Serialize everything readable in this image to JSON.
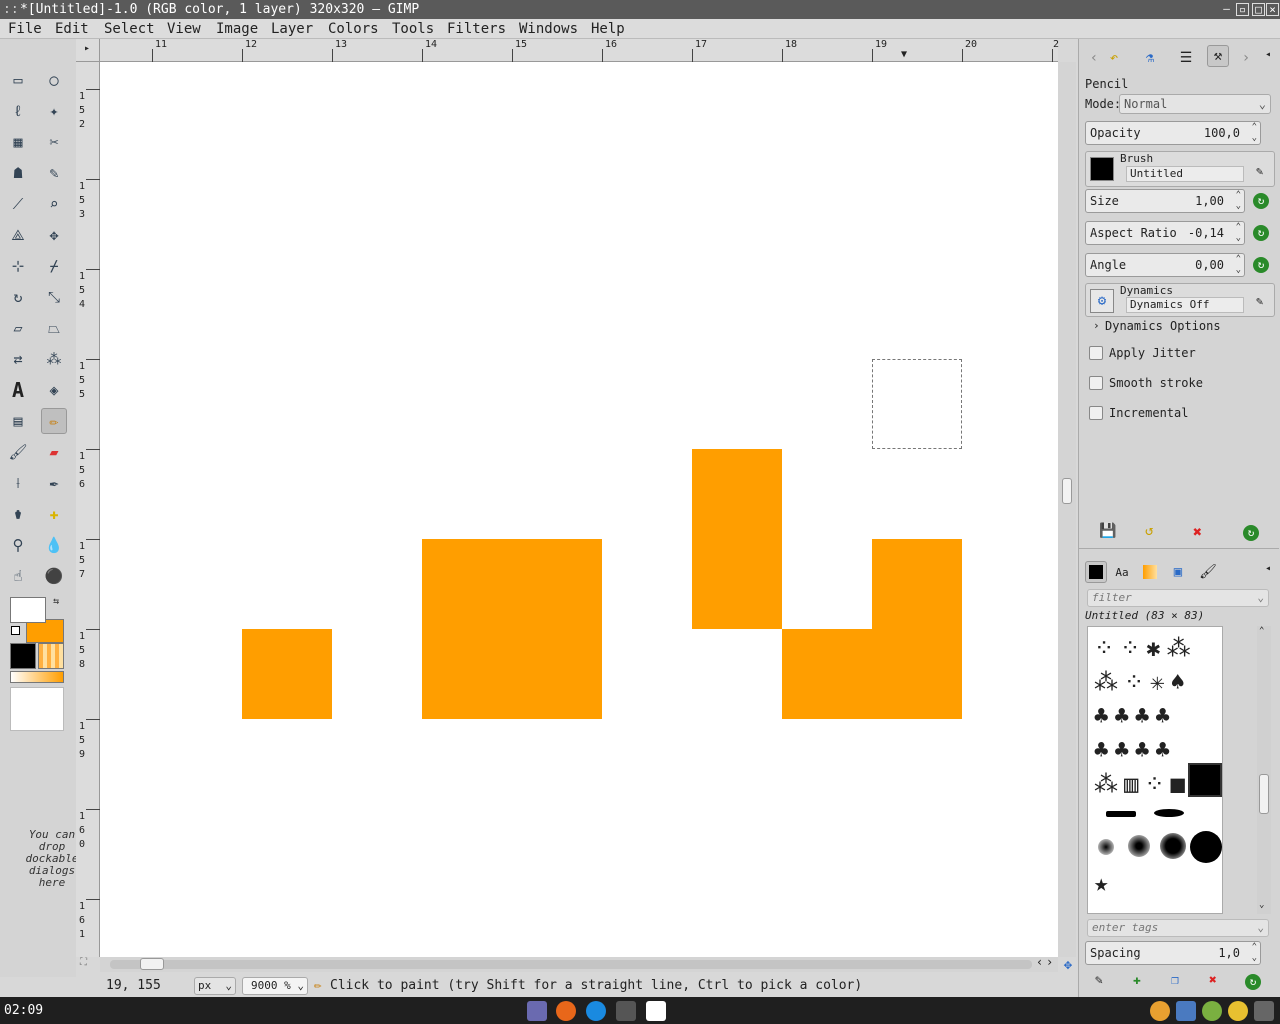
{
  "window": {
    "title": "*[Untitled]-1.0 (RGB color, 1 layer) 320x320 – GIMP",
    "grip": "::"
  },
  "menu": [
    "File",
    "Edit",
    "Select",
    "View",
    "Image",
    "Layer",
    "Colors",
    "Tools",
    "Filters",
    "Windows",
    "Help"
  ],
  "toolbox": {
    "drop_hint": "You can drop dockable dialogs here"
  },
  "rulers": {
    "horizontal": [
      "11",
      "12",
      "13",
      "14",
      "15",
      "16",
      "17",
      "18",
      "19",
      "20",
      "2"
    ],
    "vertical": [
      [
        "1",
        "5",
        "2"
      ],
      [
        "1",
        "5",
        "3"
      ],
      [
        "1",
        "5",
        "4"
      ],
      [
        "1",
        "5",
        "5"
      ],
      [
        "1",
        "5",
        "6"
      ],
      [
        "1",
        "5",
        "7"
      ],
      [
        "1",
        "5",
        "8"
      ],
      [
        "1",
        "5",
        "9"
      ],
      [
        "1",
        "6",
        "0"
      ],
      [
        "1",
        "6",
        "1"
      ]
    ]
  },
  "canvas": {
    "fill_color": "#ff9e00"
  },
  "statusbar": {
    "coords": "19, 155",
    "unit": "px",
    "zoom": "9000 %",
    "message": "Click to paint (try Shift for a straight line, Ctrl to pick a color)"
  },
  "tool_options": {
    "tool_name": "Pencil",
    "mode_label": "Mode:",
    "mode_value": "Normal",
    "opacity_label": "Opacity",
    "opacity_value": "100,0",
    "brush_label": "Brush",
    "brush_value": "Untitled",
    "size_label": "Size",
    "size_value": "1,00",
    "aspect_label": "Aspect Ratio",
    "aspect_value": "-0,14",
    "angle_label": "Angle",
    "angle_value": "0,00",
    "dynamics_label": "Dynamics",
    "dynamics_value": "Dynamics Off",
    "dynamics_options": "Dynamics Options",
    "apply_jitter": "Apply Jitter",
    "smooth_stroke": "Smooth stroke",
    "incremental": "Incremental"
  },
  "brushes": {
    "filter_placeholder": "filter",
    "current": "Untitled (83 × 83)",
    "tags_placeholder": "enter tags",
    "spacing_label": "Spacing",
    "spacing_value": "1,0"
  },
  "taskbar": {
    "clock": "02:09"
  }
}
